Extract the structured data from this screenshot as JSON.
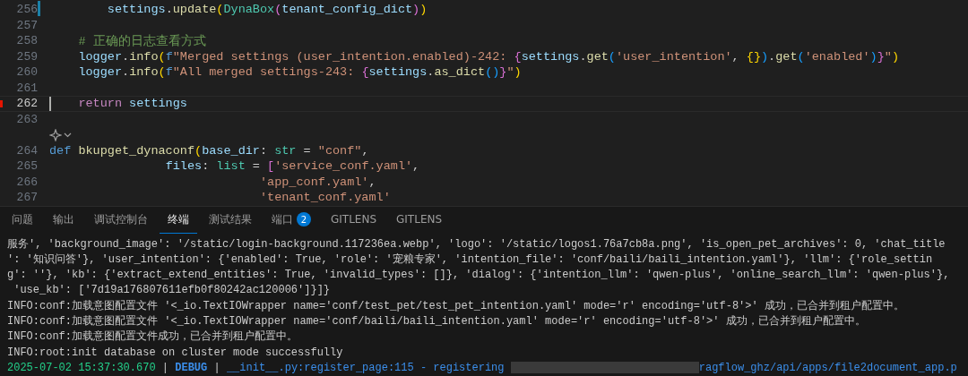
{
  "editor": {
    "lines": [
      {
        "number": "256",
        "current": false,
        "modified": true,
        "tokens": [
          {
            "kind": "var",
            "text": "        settings"
          },
          {
            "kind": "plain",
            "text": "."
          },
          {
            "kind": "fn",
            "text": "update"
          },
          {
            "kind": "p1",
            "text": "("
          },
          {
            "kind": "type",
            "text": "DynaBox"
          },
          {
            "kind": "p2",
            "text": "("
          },
          {
            "kind": "var",
            "text": "tenant_config_dict"
          },
          {
            "kind": "p2",
            "text": ")"
          },
          {
            "kind": "p1",
            "text": ")"
          }
        ]
      },
      {
        "number": "257",
        "current": false,
        "modified": false
      },
      {
        "number": "258",
        "current": false,
        "modified": false,
        "tokens": [
          {
            "kind": "comment",
            "text": "    # 正确的日志查看方式"
          }
        ]
      },
      {
        "number": "259",
        "current": false,
        "modified": false,
        "tokens": [
          {
            "kind": "var",
            "text": "    logger"
          },
          {
            "kind": "plain",
            "text": "."
          },
          {
            "kind": "fn",
            "text": "info"
          },
          {
            "kind": "p1",
            "text": "("
          },
          {
            "kind": "kw",
            "text": "f"
          },
          {
            "kind": "str",
            "text": "\"Merged settings (user_intention.enabled)-242: "
          },
          {
            "kind": "p2",
            "text": "{"
          },
          {
            "kind": "var",
            "text": "settings"
          },
          {
            "kind": "plain",
            "text": "."
          },
          {
            "kind": "fn",
            "text": "get"
          },
          {
            "kind": "p3",
            "text": "("
          },
          {
            "kind": "str",
            "text": "'user_intention'"
          },
          {
            "kind": "plain",
            "text": ", "
          },
          {
            "kind": "p1",
            "text": "{}"
          },
          {
            "kind": "p3",
            "text": ")"
          },
          {
            "kind": "plain",
            "text": "."
          },
          {
            "kind": "fn",
            "text": "get"
          },
          {
            "kind": "p3",
            "text": "("
          },
          {
            "kind": "str",
            "text": "'enabled'"
          },
          {
            "kind": "p3",
            "text": ")"
          },
          {
            "kind": "p2",
            "text": "}"
          },
          {
            "kind": "str",
            "text": "\""
          },
          {
            "kind": "p1",
            "text": ")"
          }
        ]
      },
      {
        "number": "260",
        "current": false,
        "modified": false,
        "tokens": [
          {
            "kind": "var",
            "text": "    logger"
          },
          {
            "kind": "plain",
            "text": "."
          },
          {
            "kind": "fn",
            "text": "info"
          },
          {
            "kind": "p1",
            "text": "("
          },
          {
            "kind": "kw",
            "text": "f"
          },
          {
            "kind": "str",
            "text": "\"All merged settings-243: "
          },
          {
            "kind": "p2",
            "text": "{"
          },
          {
            "kind": "var",
            "text": "settings"
          },
          {
            "kind": "plain",
            "text": "."
          },
          {
            "kind": "fn",
            "text": "as_dict"
          },
          {
            "kind": "p3",
            "text": "()"
          },
          {
            "kind": "p2",
            "text": "}"
          },
          {
            "kind": "str",
            "text": "\""
          },
          {
            "kind": "p1",
            "text": ")"
          }
        ]
      },
      {
        "number": "261",
        "current": false,
        "modified": false
      },
      {
        "number": "262",
        "current": true,
        "modified": false,
        "tokens": [
          {
            "kind": "ctl",
            "text": "    return"
          },
          {
            "kind": "var",
            "text": " settings"
          }
        ]
      },
      {
        "number": "263",
        "current": false,
        "modified": false
      },
      {
        "kind": "codelens"
      },
      {
        "number": "264",
        "current": false,
        "modified": false,
        "tokens": [
          {
            "kind": "kw",
            "text": "def "
          },
          {
            "kind": "fn",
            "text": "bkupget_dynaconf"
          },
          {
            "kind": "p1",
            "text": "("
          },
          {
            "kind": "var",
            "text": "base_dir"
          },
          {
            "kind": "plain",
            "text": ": "
          },
          {
            "kind": "type",
            "text": "str"
          },
          {
            "kind": "plain",
            "text": " = "
          },
          {
            "kind": "str",
            "text": "\"conf\""
          },
          {
            "kind": "plain",
            "text": ","
          }
        ]
      },
      {
        "number": "265",
        "current": false,
        "modified": false,
        "tokens": [
          {
            "kind": "var",
            "text": "                files"
          },
          {
            "kind": "plain",
            "text": ": "
          },
          {
            "kind": "type",
            "text": "list"
          },
          {
            "kind": "plain",
            "text": " = "
          },
          {
            "kind": "p2",
            "text": "["
          },
          {
            "kind": "str",
            "text": "'service_conf.yaml'"
          },
          {
            "kind": "plain",
            "text": ","
          }
        ]
      },
      {
        "number": "266",
        "current": false,
        "modified": false,
        "tokens": [
          {
            "kind": "str",
            "text": "                             'app_conf.yaml'"
          },
          {
            "kind": "plain",
            "text": ","
          }
        ]
      },
      {
        "number": "267",
        "current": false,
        "modified": false,
        "tokens": [
          {
            "kind": "str",
            "text": "                             'tenant_conf.yaml'"
          }
        ]
      }
    ]
  },
  "panel": {
    "tabs": [
      {
        "label": "问题",
        "selected": false
      },
      {
        "label": "输出",
        "selected": false
      },
      {
        "label": "调试控制台",
        "selected": false
      },
      {
        "label": "终端",
        "selected": true
      },
      {
        "label": "测试结果",
        "selected": false
      },
      {
        "label": "端口",
        "selected": false,
        "badge": "2"
      },
      {
        "label": "GITLENS",
        "selected": false
      },
      {
        "label": "GITLENS",
        "selected": false
      }
    ],
    "terminal": [
      [
        {
          "kind": "plain",
          "text": "服务', 'background_image': '/static/login-background.117236ea.webp', 'logo': '/static/logos1.76a7cb8a.png', 'is_open_pet_archives': 0, 'chat_title"
        }
      ],
      [
        {
          "kind": "plain",
          "text": "': '知识问答'}, 'user_intention': {'enabled': True, 'role': '宠粮专家', 'intention_file': 'conf/baili/baili_intention.yaml'}, 'llm': {'role_settin"
        }
      ],
      [
        {
          "kind": "plain",
          "text": "g': ''}, 'kb': {'extract_extend_entities': True, 'invalid_types': []}, 'dialog': {'intention_llm': 'qwen-plus', 'online_search_llm': 'qwen-plus'},"
        }
      ],
      [
        {
          "kind": "plain",
          "text": " 'use_kb': ['7d19a176807611efb0f80242ac120006']}]}"
        }
      ],
      [
        {
          "kind": "plain",
          "text": "INFO:conf:加载意图配置文件 '<_io.TextIOWrapper name='conf/test_pet/test_pet_intention.yaml' mode='r' encoding='utf-8'>' 成功，已合并到租户配置中。"
        }
      ],
      [
        {
          "kind": "plain",
          "text": "INFO:conf:加载意图配置文件 '<_io.TextIOWrapper name='conf/baili/baili_intention.yaml' mode='r' encoding='utf-8'>' 成功，已合并到租户配置中。"
        }
      ],
      [
        {
          "kind": "plain",
          "text": "INFO:conf:加载意图配置文件成功，已合并到租户配置中。"
        }
      ],
      [
        {
          "kind": "plain",
          "text": "INFO:root:init database on cluster mode successfully"
        }
      ],
      [
        {
          "kind": "time",
          "text": "2025-07-02 15:37:30.670"
        },
        {
          "kind": "plain",
          "text": " | "
        },
        {
          "kind": "level",
          "text": "DEBUG"
        },
        {
          "kind": "plain",
          "text": " | "
        },
        {
          "kind": "link",
          "text": "__init__.py:register_page:115 - registering "
        },
        {
          "kind": "redacted"
        },
        {
          "kind": "link",
          "text": "ragflow_ghz/api/apps/file2document_app.p"
        }
      ]
    ]
  }
}
